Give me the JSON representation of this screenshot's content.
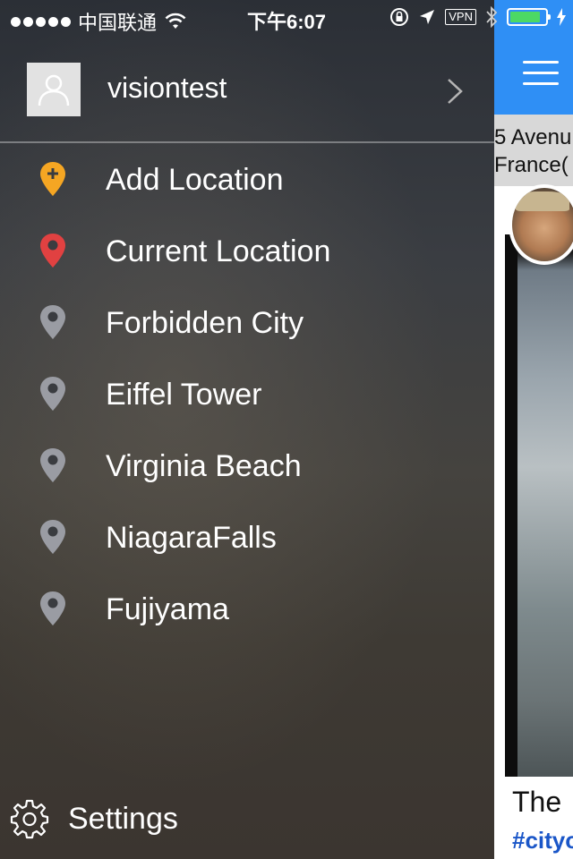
{
  "status_bar": {
    "carrier": "中国联通",
    "time": "下午6:07",
    "vpn": "VPN",
    "battery_level": 0.78
  },
  "drawer": {
    "username": "visiontest",
    "locations": [
      {
        "label": "Add Location",
        "icon": "add-location-pin-icon",
        "color": "#f5a623"
      },
      {
        "label": "Current Location",
        "icon": "current-location-pin-icon",
        "color": "#e14141"
      },
      {
        "label": "Forbidden City",
        "icon": "location-pin-icon",
        "color": "#9a9ca3"
      },
      {
        "label": "Eiffel Tower",
        "icon": "location-pin-icon",
        "color": "#9a9ca3"
      },
      {
        "label": "Virginia Beach",
        "icon": "location-pin-icon",
        "color": "#9a9ca3"
      },
      {
        "label": "NiagaraFalls",
        "icon": "location-pin-icon",
        "color": "#9a9ca3"
      },
      {
        "label": "Fujiyama",
        "icon": "location-pin-icon",
        "color": "#9a9ca3"
      }
    ],
    "settings_label": "Settings"
  },
  "main": {
    "accent_color": "#2f8ff5",
    "address_line1": "5 Avenu",
    "address_line2": "France(",
    "caption": "The",
    "hashtag": "#cityo"
  }
}
